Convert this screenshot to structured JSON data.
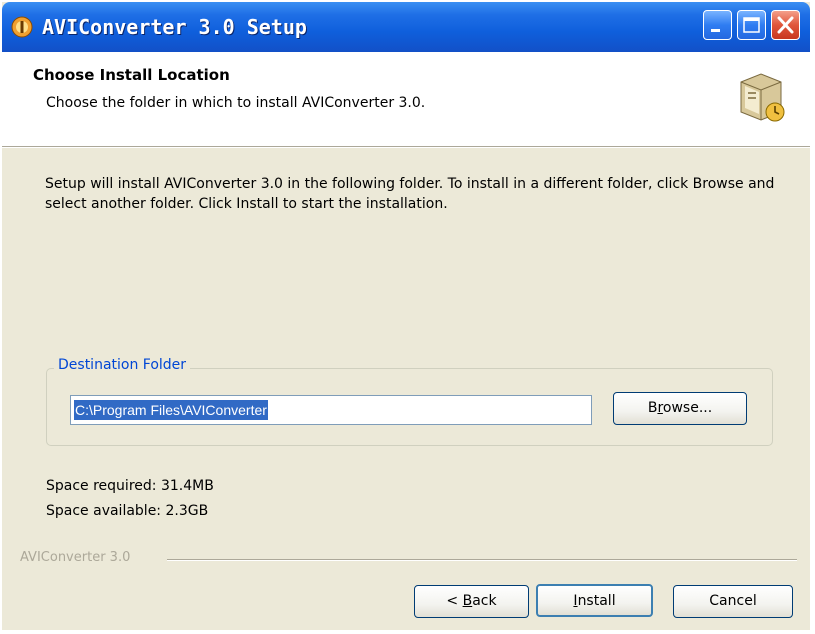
{
  "window": {
    "title": "AVIConverter 3.0 Setup",
    "controls": {
      "minimize_icon": "minimize-icon",
      "maximize_icon": "maximize-icon",
      "close_icon": "close-icon"
    }
  },
  "header": {
    "title": "Choose Install Location",
    "subtitle": "Choose the folder in which to install AVIConverter 3.0.",
    "icon": "installer-box-icon"
  },
  "body": {
    "description": "Setup will install AVIConverter 3.0 in the following folder. To install in a different folder, click Browse and select another folder. Click Install to start the installation.",
    "destination_group_label": "Destination Folder",
    "destination_path": "C:\\Program Files\\AVIConverter",
    "browse_label_pre": "B",
    "browse_label_accel": "r",
    "browse_label_post": "owse...",
    "space_required": "Space required: 31.4MB",
    "space_available": "Space available: 2.3GB"
  },
  "footer": {
    "branding": "AVIConverter 3.0",
    "back_label_pre": "< ",
    "back_label_accel": "B",
    "back_label_post": "ack",
    "install_label_accel": "I",
    "install_label_post": "nstall",
    "cancel_label": "Cancel"
  },
  "colors": {
    "titlebar": "#0f5fdc",
    "dialog_bg": "#ece9d8",
    "selection": "#316ac5",
    "group_label": "#0046d5"
  }
}
